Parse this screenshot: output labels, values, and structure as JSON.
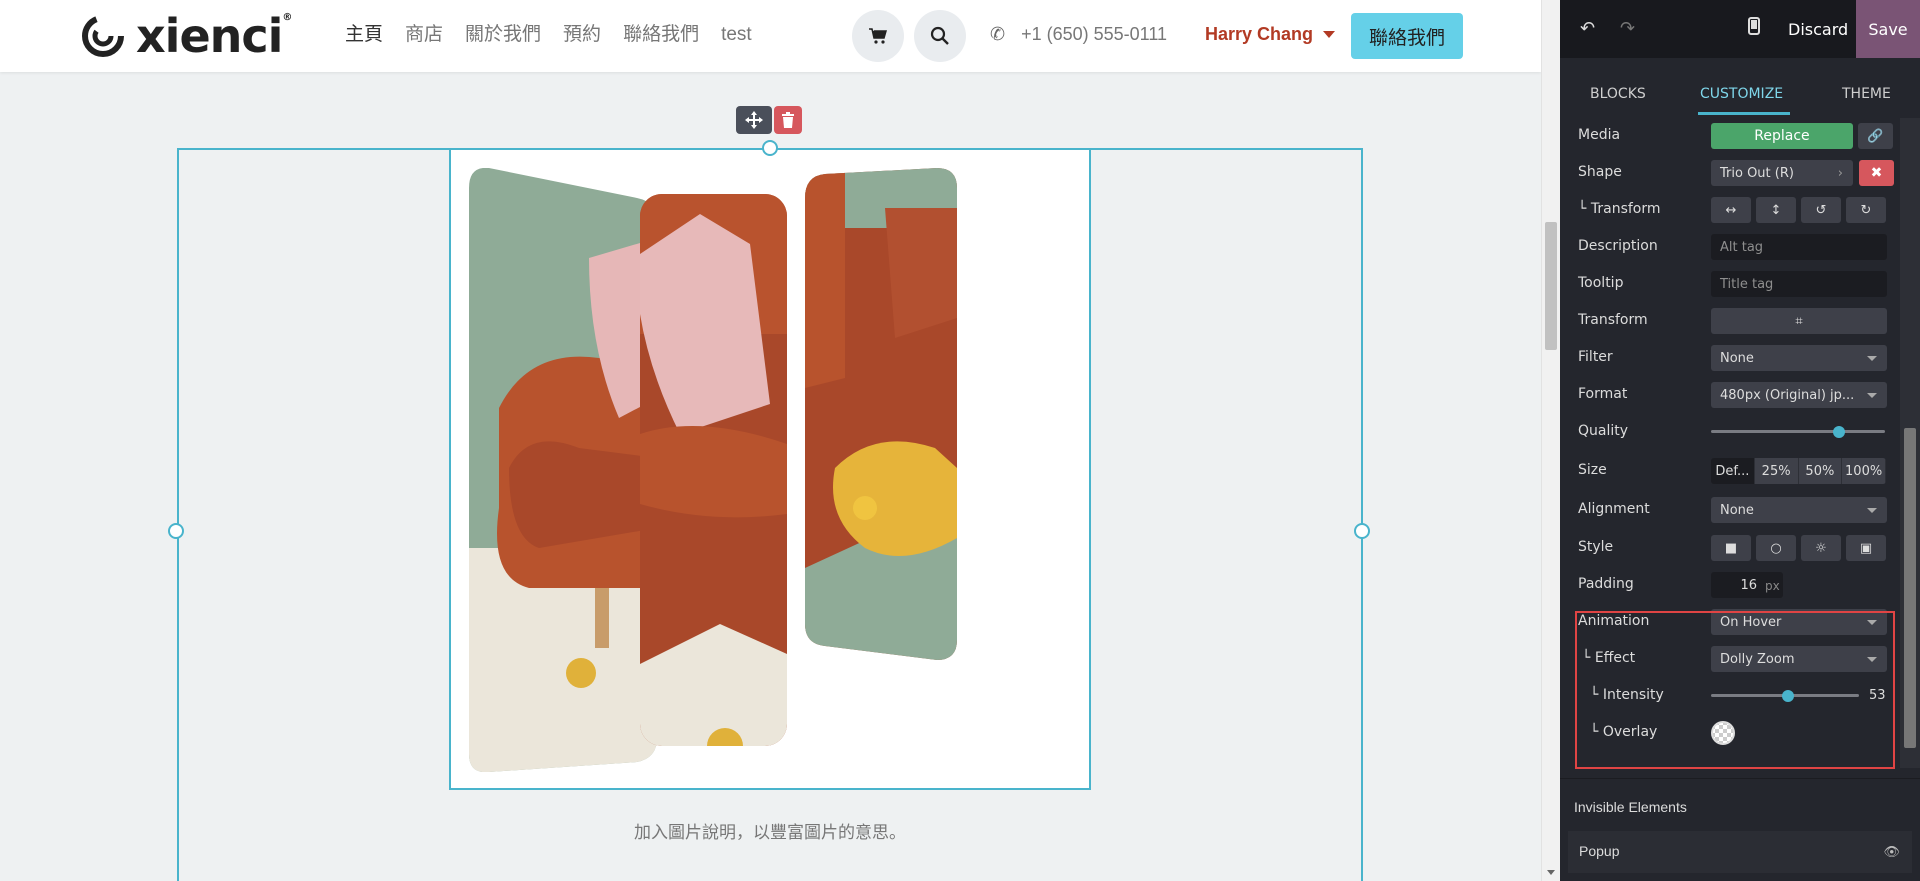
{
  "site": {
    "logo_text": "xienci",
    "logo_reg": "®",
    "nav": [
      "主頁",
      "商店",
      "關於我們",
      "預約",
      "聯絡我們",
      "test"
    ],
    "phone": "+1 (650) 555-0111",
    "user": "Harry Chang",
    "cta": "聯絡我們",
    "caption": "加入圖片說明，以豐富圖片的意思。"
  },
  "editor": {
    "discard": "Discard",
    "save": "Save",
    "tabs": [
      "BLOCKS",
      "CUSTOMIZE",
      "THEME"
    ],
    "options": {
      "media_label": "Media",
      "replace": "Replace",
      "shape_label": "Shape",
      "shape_value": "Trio Out (R)",
      "transform_sub_label": "└ Transform",
      "description_label": "Description",
      "description_placeholder": "Alt tag",
      "tooltip_label": "Tooltip",
      "tooltip_placeholder": "Title tag",
      "transform_label": "Transform",
      "filter_label": "Filter",
      "filter_value": "None",
      "format_label": "Format",
      "format_value": "480px (Original) jp...",
      "quality_label": "Quality",
      "quality_level": 0.8,
      "size_label": "Size",
      "size_options": [
        "Def...",
        "25%",
        "50%",
        "100%"
      ],
      "alignment_label": "Alignment",
      "alignment_value": "None",
      "style_label": "Style",
      "padding_label": "Padding",
      "padding_value": "16",
      "padding_unit": "px",
      "animation_label": "Animation",
      "animation_value": "On Hover",
      "effect_label": "└ Effect",
      "effect_value": "Dolly Zoom",
      "intensity_label": "└ Intensity",
      "intensity_value": "53",
      "overlay_label": "└ Overlay"
    },
    "invisible_title": "Invisible Elements",
    "popup_label": "Popup"
  },
  "colors": {
    "accent": "#49b4cc",
    "cta": "#65d0e8",
    "save": "#7a5475",
    "replace": "#4ba56a",
    "danger": "#d6575d",
    "highlight": "#e04444"
  }
}
